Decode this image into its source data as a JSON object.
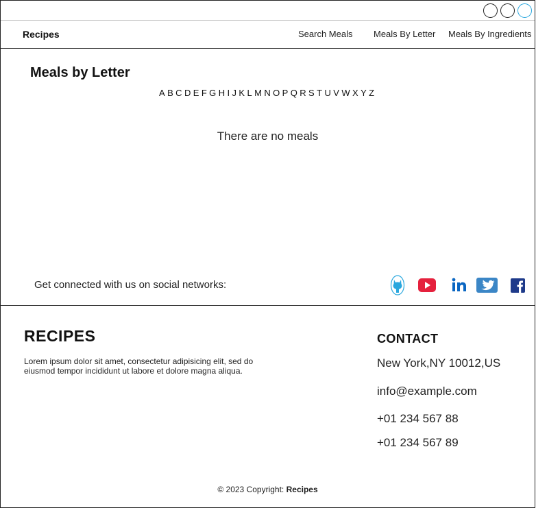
{
  "window": {
    "controls": [
      "circle-button",
      "circle-button",
      "circle-button-active"
    ]
  },
  "nav": {
    "brand": "Recipes",
    "links": [
      "Search Meals",
      "Meals By Letter",
      "Meals By Ingredients"
    ]
  },
  "main": {
    "title": "Meals by Letter",
    "letters": [
      "A",
      "B",
      "C",
      "D",
      "E",
      "F",
      "G",
      "H",
      "I",
      "J",
      "K",
      "L",
      "M",
      "N",
      "O",
      "P",
      "Q",
      "R",
      "S",
      "T",
      "U",
      "V",
      "W",
      "X",
      "Y",
      "Z"
    ],
    "empty_message": "There are no meals"
  },
  "social": {
    "text": "Get connected with us on social networks:",
    "icons": [
      "github-icon",
      "youtube-icon",
      "linkedin-icon",
      "twitter-icon",
      "facebook-icon"
    ],
    "colors": {
      "github": "#29a7de",
      "youtube": "#e5213d",
      "linkedin": "#0a66c2",
      "twitter": "#3b86c6",
      "facebook": "#1e3a8a"
    }
  },
  "footer": {
    "title": "RECIPES",
    "text": "Lorem ipsum dolor sit amet, consectetur adipisicing elit, sed do eiusmod tempor incididunt ut labore et dolore magna aliqua.",
    "contact_title": "CONTACT",
    "address": "New York,NY 10012,US",
    "email": "info@example.com",
    "phone1": "+01 234 567 88",
    "phone2": "+01 234 567 89",
    "copyright_prefix": "© 2023 Copyright:",
    "copyright_brand": "Recipes"
  }
}
